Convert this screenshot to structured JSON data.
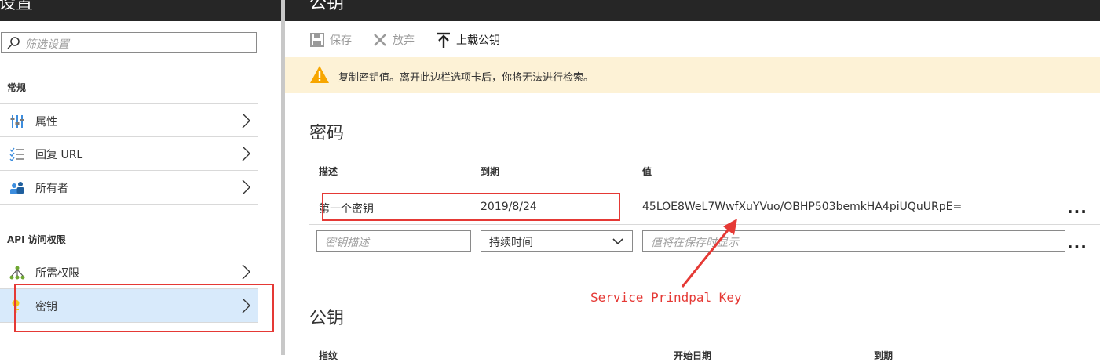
{
  "left_header_title": "设置",
  "right_header_title": "公钥",
  "sidebar": {
    "filter_placeholder": "筛选设置",
    "section_general": "常规",
    "general_items": [
      {
        "label": "属性",
        "icon": "properties-icon"
      },
      {
        "label": "回复 URL",
        "icon": "list-icon"
      },
      {
        "label": "所有者",
        "icon": "owners-icon"
      }
    ],
    "section_api": "API 访问权限",
    "api_items": [
      {
        "label": "所需权限",
        "icon": "permissions-icon"
      },
      {
        "label": "密钥",
        "icon": "key-icon",
        "selected": true
      }
    ]
  },
  "toolbar": {
    "save_label": "保存",
    "discard_label": "放弃",
    "upload_label": "上载公钥"
  },
  "warning": {
    "text": "复制密钥值。离开此边栏选项卡后，你将无法进行检索。"
  },
  "passwords": {
    "heading": "密码",
    "columns": [
      "描述",
      "到期",
      "值"
    ],
    "rows": [
      {
        "description": "第一个密钥",
        "expires": "2019/8/24",
        "value": "45LOE8WeL7WwfXuYVuo/OBHP503bemkHA4piUQuURpE="
      }
    ],
    "new_row": {
      "description_placeholder": "密钥描述",
      "duration_value": "持续时间",
      "value_placeholder": "值将在保存时显示"
    },
    "more_label": "..."
  },
  "public_keys": {
    "heading": "公钥",
    "columns": [
      "指纹",
      "开始日期",
      "到期"
    ]
  },
  "annotation": {
    "text": "Service Prindpal Key",
    "color": "#e53935"
  },
  "colors": {
    "warning_bg": "#fdf2d6",
    "warning_icon": "#f7a600",
    "selected_bg": "#d8eafb",
    "header_bg": "#262626"
  }
}
